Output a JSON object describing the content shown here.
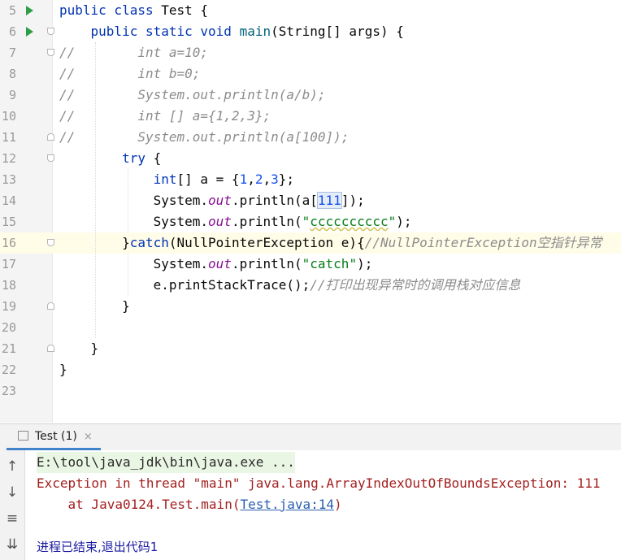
{
  "editor": {
    "lines": [
      {
        "n": "5",
        "run": true,
        "fold": "",
        "current": false,
        "segs": [
          [
            "kw",
            "public class "
          ],
          [
            "",
            "Test {"
          ]
        ]
      },
      {
        "n": "6",
        "run": true,
        "fold": "start",
        "current": false,
        "segs": [
          [
            "kw",
            "    public static void "
          ],
          [
            "fn",
            "main"
          ],
          [
            "",
            "(String[] args) {"
          ]
        ]
      },
      {
        "n": "7",
        "run": false,
        "fold": "start",
        "current": false,
        "segs": [
          [
            "cm",
            "//        int a=10;"
          ]
        ]
      },
      {
        "n": "8",
        "run": false,
        "fold": "",
        "current": false,
        "segs": [
          [
            "cm",
            "//        int b=0;"
          ]
        ]
      },
      {
        "n": "9",
        "run": false,
        "fold": "",
        "current": false,
        "segs": [
          [
            "cm",
            "//        System.out.println(a/b);"
          ]
        ]
      },
      {
        "n": "10",
        "run": false,
        "fold": "",
        "current": false,
        "segs": [
          [
            "cm",
            "//        int [] a={1,2,3};"
          ]
        ]
      },
      {
        "n": "11",
        "run": false,
        "fold": "end",
        "current": false,
        "segs": [
          [
            "cm",
            "//        System.out.println(a[100]);"
          ]
        ]
      },
      {
        "n": "12",
        "run": false,
        "fold": "start",
        "current": false,
        "segs": [
          [
            "",
            "        "
          ],
          [
            "kw",
            "try"
          ],
          [
            "",
            " {"
          ]
        ]
      },
      {
        "n": "13",
        "run": false,
        "fold": "",
        "current": false,
        "segs": [
          [
            "",
            "            "
          ],
          [
            "kw",
            "int"
          ],
          [
            "",
            "[] a = {"
          ],
          [
            "nm",
            "1"
          ],
          [
            "",
            ","
          ],
          [
            "nm",
            "2"
          ],
          [
            "",
            ","
          ],
          [
            "nm",
            "3"
          ],
          [
            "",
            "};"
          ]
        ]
      },
      {
        "n": "14",
        "run": false,
        "fold": "",
        "current": false,
        "segs": [
          [
            "",
            "            System."
          ],
          [
            "fld",
            "out"
          ],
          [
            "",
            ".println(a["
          ],
          [
            "nm hl",
            "111"
          ],
          [
            "",
            "]);"
          ]
        ]
      },
      {
        "n": "15",
        "run": false,
        "fold": "",
        "current": false,
        "segs": [
          [
            "",
            "            System."
          ],
          [
            "fld",
            "out"
          ],
          [
            "",
            ".println("
          ],
          [
            "st",
            "\""
          ],
          [
            "st sq",
            "cccccccccc"
          ],
          [
            "st",
            "\""
          ],
          [
            "",
            ");"
          ]
        ]
      },
      {
        "n": "16",
        "run": false,
        "fold": "start",
        "current": true,
        "segs": [
          [
            "",
            "        }"
          ],
          [
            "kw",
            "catch"
          ],
          [
            "",
            "(NullPointerException e){"
          ],
          [
            "cm",
            "//NullPointerException空指针异常"
          ]
        ]
      },
      {
        "n": "17",
        "run": false,
        "fold": "",
        "current": false,
        "segs": [
          [
            "",
            "            System."
          ],
          [
            "fld",
            "out"
          ],
          [
            "",
            ".println("
          ],
          [
            "st",
            "\"catch\""
          ],
          [
            "",
            ");"
          ]
        ]
      },
      {
        "n": "18",
        "run": false,
        "fold": "",
        "current": false,
        "segs": [
          [
            "",
            "            e.printStackTrace();"
          ],
          [
            "cm",
            "//打印出现异常时的调用栈对应信息"
          ]
        ]
      },
      {
        "n": "19",
        "run": false,
        "fold": "end",
        "current": false,
        "segs": [
          [
            "",
            "        }"
          ]
        ]
      },
      {
        "n": "20",
        "run": false,
        "fold": "",
        "current": false,
        "segs": []
      },
      {
        "n": "21",
        "run": false,
        "fold": "end",
        "current": false,
        "segs": [
          [
            "",
            "    }"
          ]
        ]
      },
      {
        "n": "22",
        "run": false,
        "fold": "",
        "current": false,
        "segs": [
          [
            "",
            "}"
          ]
        ]
      },
      {
        "n": "23",
        "run": false,
        "fold": "",
        "current": false,
        "segs": []
      }
    ]
  },
  "run_panel": {
    "tab_label": "Test (1)",
    "close_glyph": "×",
    "tool_icons": [
      "↑",
      "↓",
      "≡",
      "⇊"
    ]
  },
  "console": {
    "cmd_line": "E:\\tool\\java_jdk\\bin\\java.exe ...",
    "exception_line": "Exception in thread \"main\" java.lang.ArrayIndexOutOfBoundsException: 111",
    "trace_prefix": "    at Java0124.Test.main(",
    "trace_link": "Test.java:14",
    "trace_suffix": ")",
    "exit_line": "进程已结束,退出代码1"
  }
}
